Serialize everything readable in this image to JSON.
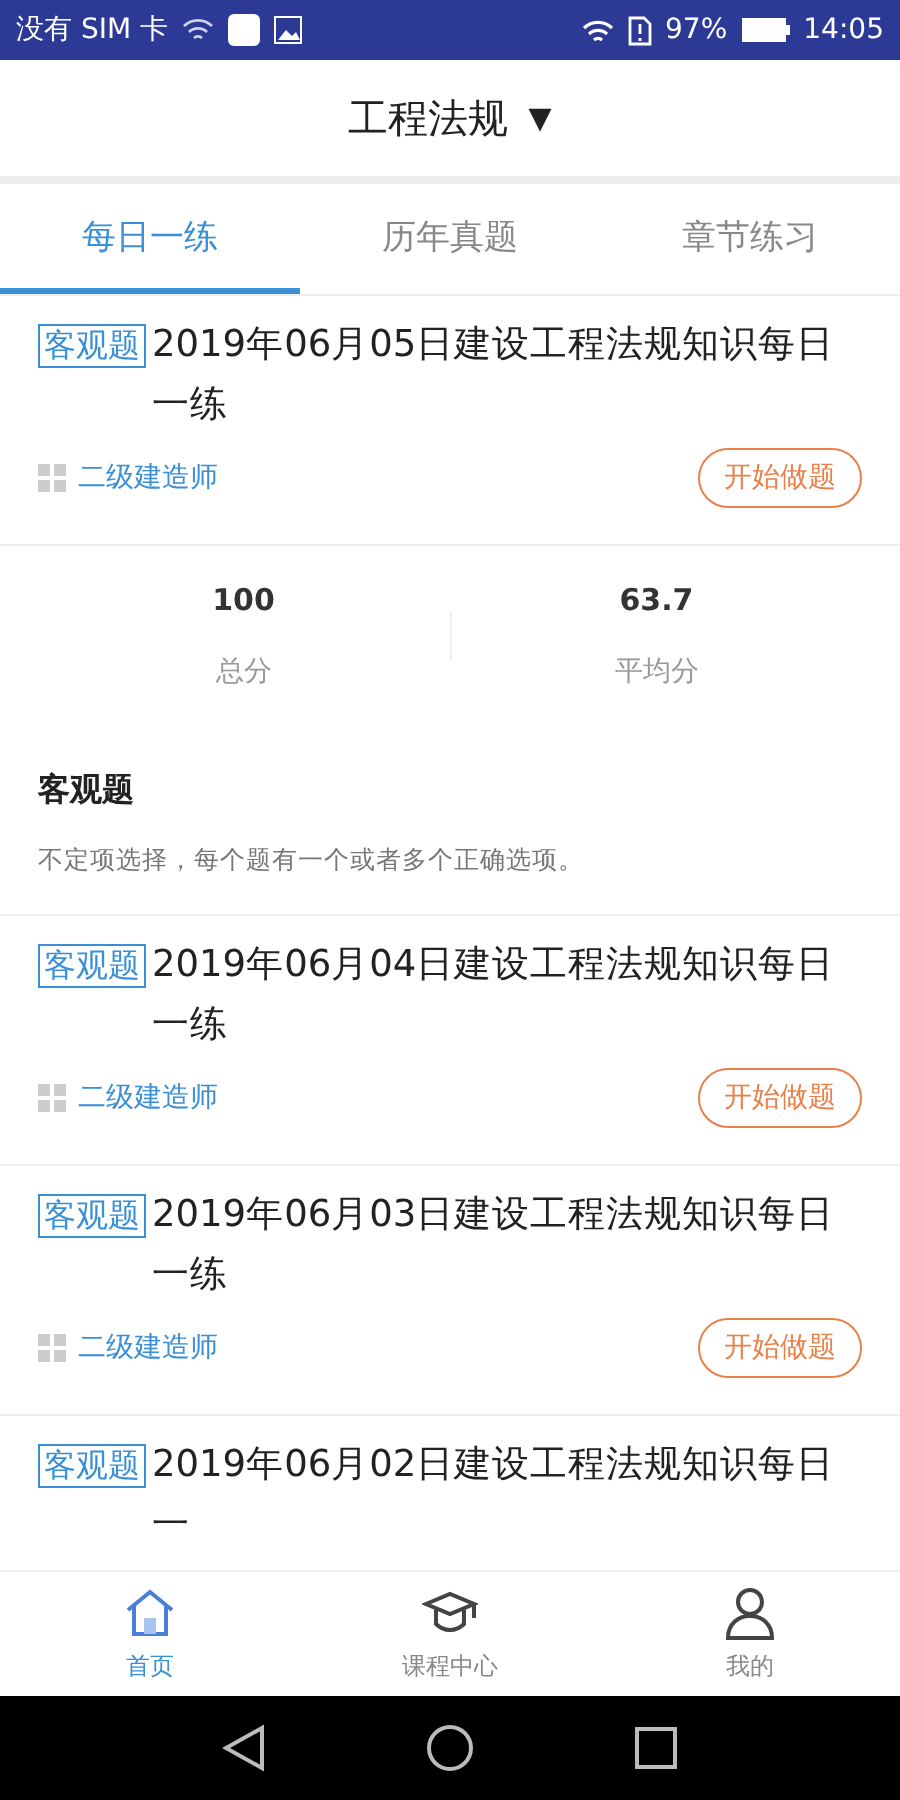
{
  "status_bar": {
    "carrier": "没有 SIM 卡",
    "battery": "97%",
    "time": "14:05"
  },
  "header": {
    "title": "工程法规",
    "caret": "▼"
  },
  "tabs": [
    {
      "label": "每日一练",
      "selected": true
    },
    {
      "label": "历年真题",
      "selected": false
    },
    {
      "label": "章节练习",
      "selected": false
    }
  ],
  "exercises": [
    {
      "tag": "客观题",
      "title": "2019年06月05日建设工程法规知识每日一练",
      "category": "二级建造师",
      "button": "开始做题"
    },
    {
      "kind": "summary",
      "stats": [
        {
          "value": "100",
          "label": "总分"
        },
        {
          "value": "63.7",
          "label": "平均分"
        }
      ],
      "section_title": "客观题",
      "section_note": "不定项选择，每个题有一个或者多个正确选项。"
    },
    {
      "tag": "客观题",
      "title": "2019年06月04日建设工程法规知识每日一练",
      "category": "二级建造师",
      "button": "开始做题"
    },
    {
      "tag": "客观题",
      "title": "2019年06月03日建设工程法规知识每日一练",
      "category": "二级建造师",
      "button": "开始做题"
    },
    {
      "tag": "客观题",
      "title": "2019年06月02日建设工程法规知识每日一"
    }
  ],
  "bottom_nav": [
    {
      "label": "首页",
      "selected": true
    },
    {
      "label": "课程中心",
      "selected": false
    },
    {
      "label": "我的",
      "selected": false
    }
  ]
}
